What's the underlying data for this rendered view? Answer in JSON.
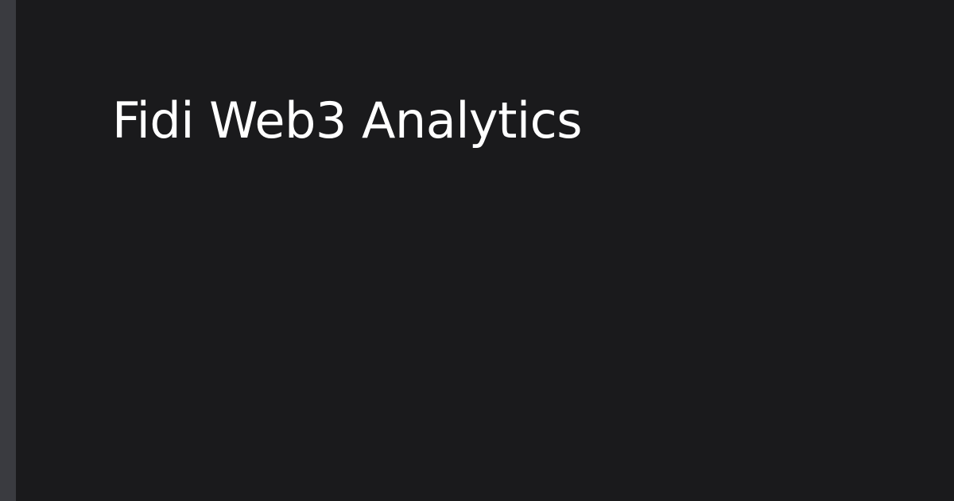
{
  "card": {
    "title": "Fidi Web3 Analytics"
  },
  "colors": {
    "background": "#1a1a1c",
    "accent_bar": "#3a3b40",
    "title_text": "#ffffff"
  }
}
